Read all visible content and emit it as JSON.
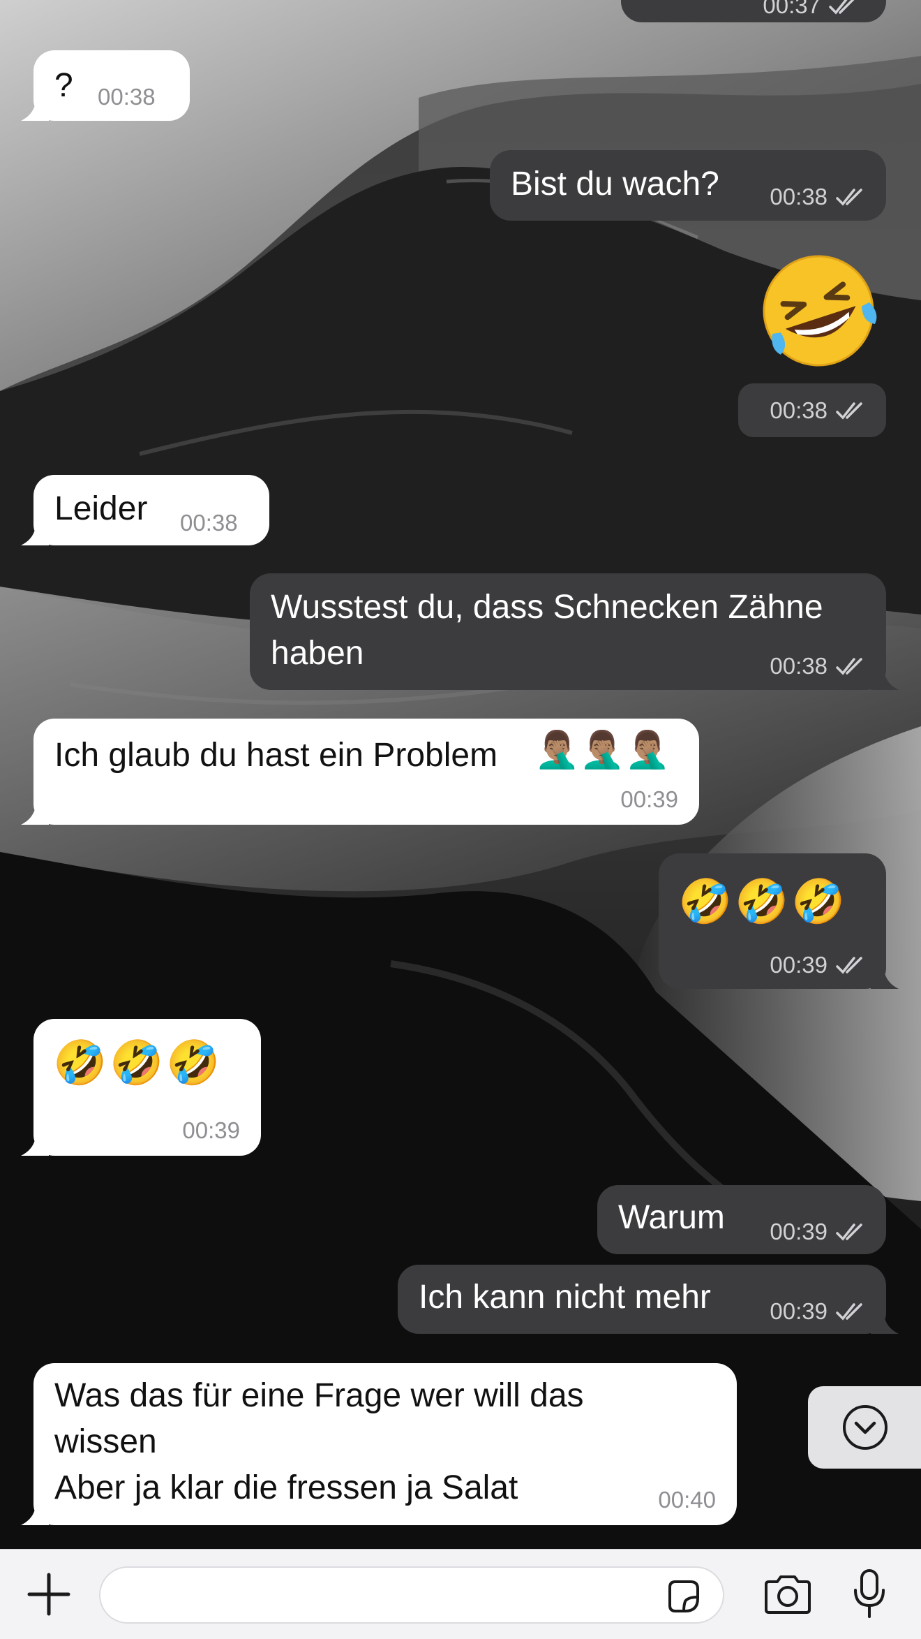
{
  "messages": [
    {
      "text": "",
      "time": "00:37"
    },
    {
      "text": "?",
      "time": "00:38"
    },
    {
      "text": "Bist du wach?",
      "time": "00:38"
    },
    {
      "text": "🤣",
      "time": "00:38"
    },
    {
      "text": "Leider",
      "time": "00:38"
    },
    {
      "text": "Wusstest du, dass Schnecken Zähne haben",
      "time": "00:38"
    },
    {
      "text": "Ich glaub du hast ein Problem",
      "text_emoji": "🤦🏽‍♂️🤦🏽‍♂️🤦🏽‍♂️",
      "time": "00:39"
    },
    {
      "text": "🤣🤣🤣",
      "time": "00:39"
    },
    {
      "text": "🤣🤣🤣",
      "time": "00:39"
    },
    {
      "text": "Warum",
      "time": "00:39"
    },
    {
      "text": "Ich kann nicht mehr",
      "time": "00:39"
    },
    {
      "text_line1": "Was das für eine Frage wer will das wissen",
      "text_line2": "Aber ja klar die fressen ja Salat",
      "time": "00:40"
    }
  ],
  "composer": {
    "placeholder": "",
    "icons": [
      "plus-icon",
      "sticker-icon",
      "camera-icon",
      "microphone-icon"
    ]
  },
  "scroll_button": {
    "icon": "chevron-down-icon"
  },
  "colors": {
    "incoming_bubble": "#ffffff",
    "outgoing_bubble": "#3c3c3e",
    "composer_bg": "#f3f3f5"
  }
}
